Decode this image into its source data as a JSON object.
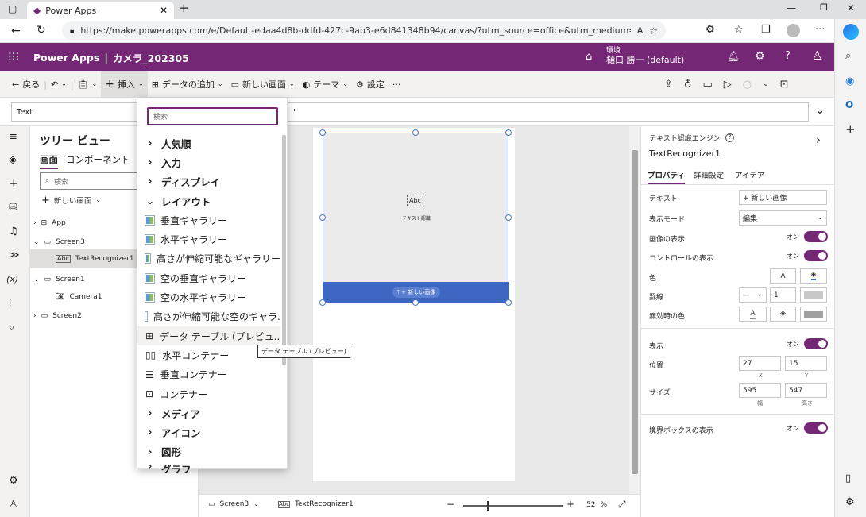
{
  "browser": {
    "tab_title": "Power Apps",
    "url": "https://make.powerapps.com/e/Default-edaa4d8b-ddfd-427c-9ab3-e6d841348b94/canvas/?utm_source=office&utm_medium=app_launcher&utm_..."
  },
  "header": {
    "product": "Power Apps",
    "separator": "|",
    "app_name": "カメラ_202305",
    "env_label": "環境",
    "env_name": "樋口 勝一 (default)"
  },
  "cmd": {
    "back": "戻る",
    "insert": "挿入",
    "add_data": "データの追加",
    "new_screen": "新しい画面",
    "theme": "テーマ",
    "settings": "設定",
    "more": "···"
  },
  "formula": {
    "property": "Text",
    "value": "\""
  },
  "tree": {
    "title": "ツリー ビュー",
    "tab_screens": "画面",
    "tab_components": "コンポーネント",
    "search_placeholder": "検索",
    "new_screen": "新しい画面",
    "items": [
      {
        "label": "App"
      },
      {
        "label": "Screen3"
      },
      {
        "label": "TextRecognizer1"
      },
      {
        "label": "Screen1"
      },
      {
        "label": "Camera1"
      },
      {
        "label": "Screen2"
      }
    ]
  },
  "insert": {
    "search_placeholder": "検索",
    "rows": [
      {
        "label": "人気順",
        "kind": "cat"
      },
      {
        "label": "入力",
        "kind": "cat"
      },
      {
        "label": "ディスプレイ",
        "kind": "cat"
      },
      {
        "label": "レイアウト",
        "kind": "catopen"
      },
      {
        "label": "垂直ギャラリー",
        "kind": "gal"
      },
      {
        "label": "水平ギャラリー",
        "kind": "gal"
      },
      {
        "label": "高さが伸縮可能なギャラリー",
        "kind": "gal"
      },
      {
        "label": "空の垂直ギャラリー",
        "kind": "gal"
      },
      {
        "label": "空の水平ギャラリー",
        "kind": "gal"
      },
      {
        "label": "高さが伸縮可能な空のギャラ...",
        "kind": "gal"
      },
      {
        "label": "データ テーブル (プレビュ...",
        "kind": "table"
      },
      {
        "label": "水平コンテナー",
        "kind": "hcont"
      },
      {
        "label": "垂直コンテナー",
        "kind": "vcont"
      },
      {
        "label": "コンテナー",
        "kind": "cont"
      },
      {
        "label": "メディア",
        "kind": "cat"
      },
      {
        "label": "アイコン",
        "kind": "cat"
      },
      {
        "label": "図形",
        "kind": "cat"
      },
      {
        "label": "グラフ",
        "kind": "cat"
      }
    ],
    "tooltip": "データ テーブル (プレビュー)"
  },
  "canvas": {
    "control_label": "テキスト認識",
    "button_label": "+ 新しい画像"
  },
  "status": {
    "screen": "Screen3",
    "control": "TextRecognizer1",
    "zoom": "52",
    "zoom_unit": "%"
  },
  "props": {
    "type": "テキスト認識エンジン",
    "name": "TextRecognizer1",
    "tab_props": "プロパティ",
    "tab_adv": "詳細設定",
    "tab_ideas": "アイデア",
    "text_label": "テキスト",
    "text_value": "+ 新しい画像",
    "mode_label": "表示モード",
    "mode_value": "編集",
    "showimg_label": "画像の表示",
    "on": "オン",
    "showctl_label": "コントロールの表示",
    "color_label": "色",
    "color_a": "A",
    "border_label": "罫線",
    "border_value": "1",
    "disabled_label": "無効時の色",
    "visible_label": "表示",
    "pos_label": "位置",
    "pos_x": "27",
    "pos_y": "15",
    "x": "X",
    "y": "Y",
    "size_label": "サイズ",
    "size_w": "595",
    "size_h": "547",
    "w": "幅",
    "h": "高さ",
    "bbox_label": "境界ボックスの表示"
  },
  "colors": {
    "brand": "#742774",
    "button_blue": "#3d66c2"
  }
}
